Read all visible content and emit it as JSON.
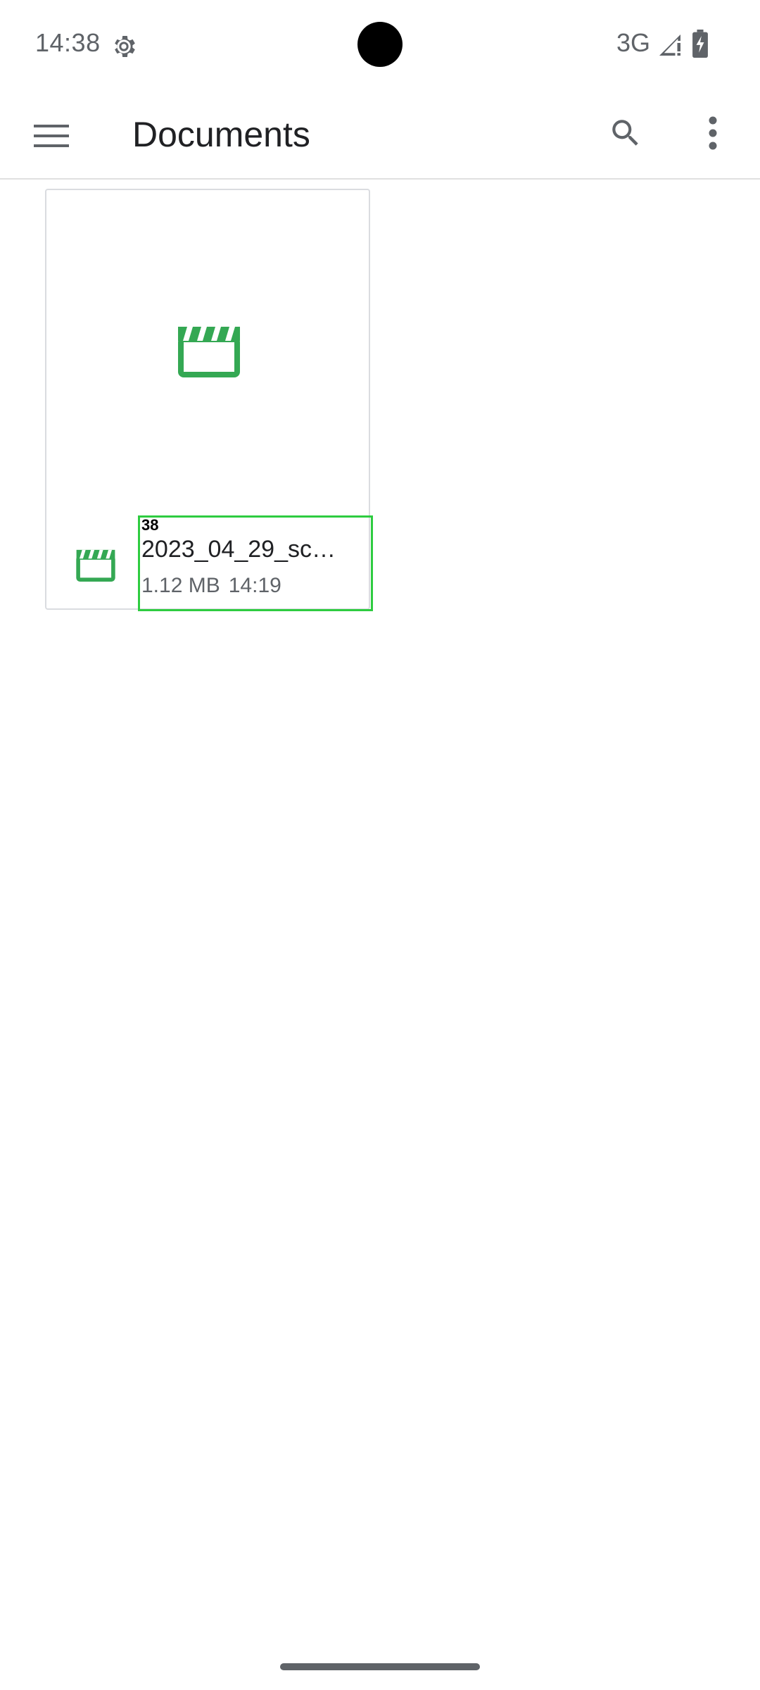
{
  "status_bar": {
    "time": "14:38",
    "network": "3G",
    "icons": [
      "settings-gear-icon",
      "signal-icon",
      "battery-charging-icon"
    ]
  },
  "app_bar": {
    "title": "Documents",
    "icons": [
      "menu-icon",
      "search-icon",
      "more-vert-icon"
    ]
  },
  "files": [
    {
      "badge": "38",
      "name": "2023_04_29_sc…",
      "size": "1.12 MB",
      "time": "14:19",
      "type_icon": "video-clapperboard-icon"
    }
  ],
  "colors": {
    "accent_video": "#34a853",
    "highlight_box": "#2ecc40",
    "text_primary": "#202124",
    "text_secondary": "#5f6368",
    "divider": "#e0e0e0"
  }
}
